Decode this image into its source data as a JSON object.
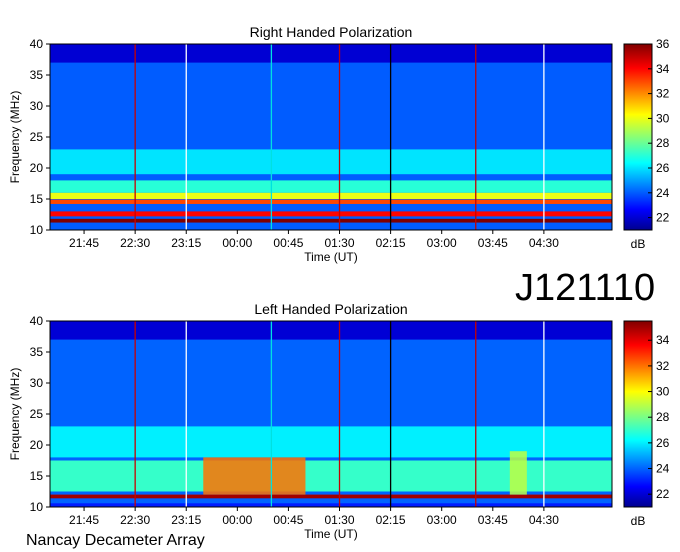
{
  "observation_id": "J121110",
  "instrument": "Nancay Decameter Array",
  "chart_data": [
    {
      "type": "heatmap",
      "title": "Right Handed Polarization",
      "xlabel": "Time (UT)",
      "ylabel": "Frequency (MHz)",
      "x_ticks": [
        "21:45",
        "22:30",
        "23:15",
        "00:00",
        "00:45",
        "01:30",
        "02:15",
        "03:00",
        "03:45",
        "04:30"
      ],
      "y_ticks": [
        10,
        15,
        20,
        25,
        30,
        35,
        40
      ],
      "ylim": [
        10,
        40
      ],
      "colorbar": {
        "unit": "dB",
        "ticks": [
          22,
          24,
          26,
          28,
          30,
          32,
          34,
          36
        ],
        "range": [
          21,
          36
        ]
      },
      "background_level_db": 24,
      "bands": [
        {
          "freq": [
            37,
            40
          ],
          "db": 22
        },
        {
          "freq": [
            24,
            33
          ],
          "db": 24
        },
        {
          "freq": [
            19,
            23
          ],
          "db": 26
        },
        {
          "freq": [
            16,
            18
          ],
          "db": 27
        },
        {
          "freq": [
            15,
            16
          ],
          "db": 30
        },
        {
          "freq": [
            14.2,
            14.9
          ],
          "db": 33
        },
        {
          "freq": [
            12.2,
            13.0
          ],
          "db": 34
        },
        {
          "freq": [
            11.2,
            11.8
          ],
          "db": 36
        },
        {
          "freq": [
            10.0,
            10.6
          ],
          "db": 24
        }
      ],
      "markers": {
        "red": [
          "22:30",
          "01:30",
          "03:30"
        ],
        "white": [
          "23:15",
          "04:30"
        ],
        "black": [
          "02:15"
        ],
        "cyan": [
          "00:30"
        ]
      }
    },
    {
      "type": "heatmap",
      "title": "Left Handed Polarization",
      "xlabel": "Time (UT)",
      "ylabel": "Frequency (MHz)",
      "x_ticks": [
        "21:45",
        "22:30",
        "23:15",
        "00:00",
        "00:45",
        "01:30",
        "02:15",
        "03:00",
        "03:45",
        "04:30"
      ],
      "y_ticks": [
        10,
        15,
        20,
        25,
        30,
        35,
        40
      ],
      "ylim": [
        10,
        40
      ],
      "colorbar": {
        "unit": "dB",
        "ticks": [
          22,
          24,
          26,
          28,
          30,
          32,
          34
        ],
        "range": [
          21,
          35.5
        ]
      },
      "background_level_db": 24,
      "bands": [
        {
          "freq": [
            37,
            40
          ],
          "db": 22
        },
        {
          "freq": [
            24,
            33
          ],
          "db": 24
        },
        {
          "freq": [
            18,
            23
          ],
          "db": 26
        },
        {
          "freq": [
            12.5,
            17.5
          ],
          "db": 27
        },
        {
          "freq": [
            11.4,
            12.0
          ],
          "db": 35
        },
        {
          "freq": [
            10.0,
            10.6
          ],
          "db": 23
        }
      ],
      "bursts": [
        {
          "time": [
            "23:30",
            "01:00"
          ],
          "freq": [
            12,
            18
          ],
          "db": 32
        },
        {
          "time": [
            "04:00",
            "04:15"
          ],
          "freq": [
            12,
            19
          ],
          "db": 29
        }
      ],
      "markers": {
        "red": [
          "22:30",
          "01:30",
          "03:30"
        ],
        "white": [
          "23:15",
          "04:30"
        ],
        "black": [
          "02:15"
        ],
        "cyan": [
          "00:30"
        ]
      }
    }
  ]
}
